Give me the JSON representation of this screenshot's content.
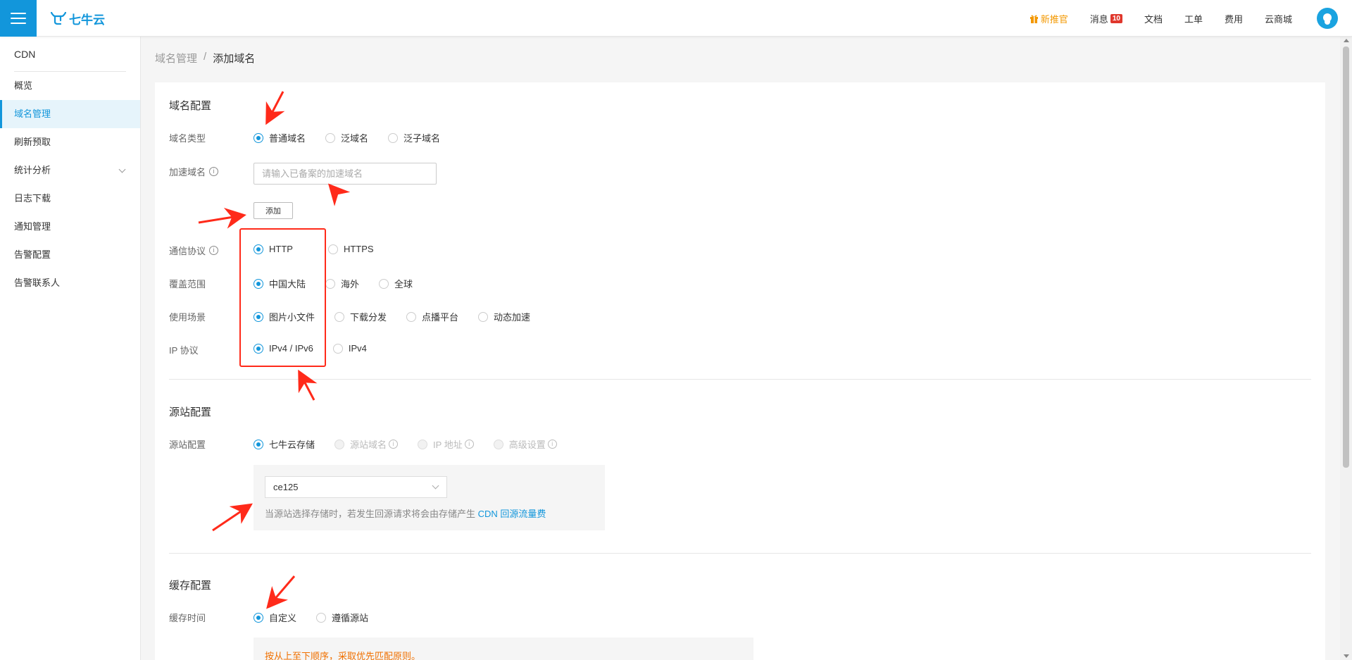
{
  "header": {
    "logo_text": "七牛云",
    "nav": [
      {
        "label": "新推官",
        "icon": "gift-icon"
      },
      {
        "label": "消息",
        "badge": "10"
      },
      {
        "label": "文档"
      },
      {
        "label": "工单"
      },
      {
        "label": "费用"
      },
      {
        "label": "云商城"
      }
    ]
  },
  "sidebar": {
    "title": "CDN",
    "items": [
      {
        "label": "概览"
      },
      {
        "label": "域名管理",
        "active": true
      },
      {
        "label": "刷新预取"
      },
      {
        "label": "统计分析",
        "expandable": true
      },
      {
        "label": "日志下载"
      },
      {
        "label": "通知管理"
      },
      {
        "label": "告警配置"
      },
      {
        "label": "告警联系人"
      }
    ]
  },
  "breadcrumb": {
    "parent": "域名管理",
    "separator": "/",
    "current": "添加域名"
  },
  "domain_config": {
    "title": "域名配置",
    "domain_type": {
      "label": "域名类型",
      "options": [
        "普通域名",
        "泛域名",
        "泛子域名"
      ],
      "selected": "普通域名"
    },
    "accel_domain": {
      "label": "加速域名",
      "placeholder": "请输入已备案的加速域名",
      "value": ""
    },
    "add_button": "添加",
    "protocol": {
      "label": "通信协议",
      "options": [
        "HTTP",
        "HTTPS"
      ],
      "selected": "HTTP"
    },
    "coverage": {
      "label": "覆盖范围",
      "options": [
        "中国大陆",
        "海外",
        "全球"
      ],
      "selected": "中国大陆"
    },
    "scenario": {
      "label": "使用场景",
      "options": [
        "图片小文件",
        "下载分发",
        "点播平台",
        "动态加速"
      ],
      "selected": "图片小文件"
    },
    "ip_protocol": {
      "label": "IP 协议",
      "options": [
        "IPv4 / IPv6",
        "IPv4"
      ],
      "selected": "IPv4 / IPv6"
    }
  },
  "origin_config": {
    "title": "源站配置",
    "label": "源站配置",
    "options": [
      "七牛云存储",
      "源站域名",
      "IP 地址",
      "高级设置"
    ],
    "selected": "七牛云存储",
    "bucket_value": "ce125",
    "hint_text": "当源站选择存储时，若发生回源请求将会由存储产生",
    "hint_link": "CDN 回源流量费"
  },
  "cache_config": {
    "title": "缓存配置",
    "label": "缓存时间",
    "options": [
      "自定义",
      "遵循源站"
    ],
    "selected": "自定义",
    "tip": "按从上至下顺序，采取优先匹配原则。"
  },
  "colors": {
    "brand": "#1296db",
    "annotation": "#ff2a1a",
    "warning": "#f07000"
  }
}
